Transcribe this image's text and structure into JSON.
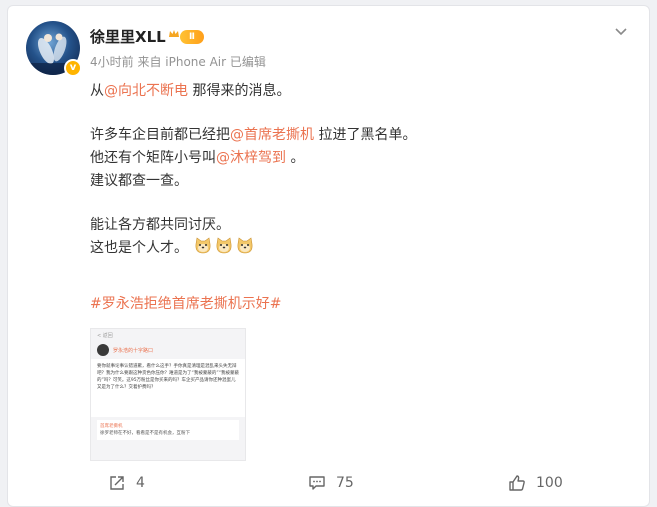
{
  "author": {
    "name": "徐里里XLL",
    "level_badge": "Ⅱ",
    "avatar_icon": "avatar-image",
    "verified_icon": "verified-badge-icon"
  },
  "post_meta": {
    "time": "4小时前",
    "source": "来自 iPhone Air",
    "edited": "已编辑",
    "meta_line": "4小时前  来自 iPhone Air 已编辑"
  },
  "content": {
    "line1_prefix": "从",
    "line1_mention": "@向北不断电",
    "line1_suffix": " 那得来的消息。",
    "line2_prefix": "许多车企目前都已经把",
    "line2_mention": "@首席老撕机",
    "line2_suffix": " 拉进了黑名单。",
    "line3_prefix": "他还有个矩阵小号叫",
    "line3_mention": "@沐梓驾到",
    "line3_suffix": " 。",
    "line4": "建议都查一查。",
    "line5": "能让各方都共同讨厌。",
    "line6": "这也是个人才。",
    "emojis": [
      "doge-icon",
      "doge-icon",
      "doge-icon"
    ],
    "hashtag": "#罗永浩拒绝首席老撕机示好#"
  },
  "attached_image": {
    "head": "< 返回",
    "user": "罗永浩的十字路口",
    "text": "要你就事论事认错道歉，看什么这手？手你真是清理是混乱来头失无辩吧？我为什么要跟这种货色你压你？难道是为了“我被蒙蔽的”“我被蒙蔽的”吗？可笑。这95万粉丝是你买来的吗？车企买产品请你还种混蛋儿又是为了什么？交着护费吗？",
    "reply_name": "首席老撕机",
    "reply_text": "徐罗老师在不好，看看是不是有机会，互粉下"
  },
  "actions": {
    "share_count": "4",
    "comment_count": "75",
    "like_count": "100"
  },
  "colors": {
    "mention": "#eb7350",
    "badge": "#ffb400"
  }
}
